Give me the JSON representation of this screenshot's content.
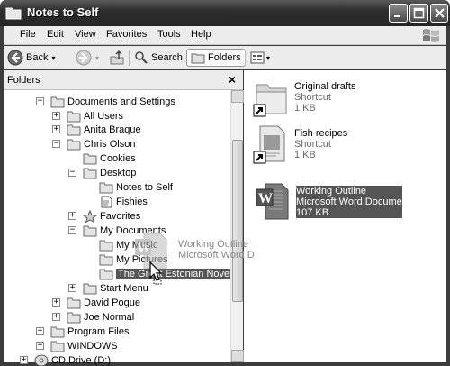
{
  "window": {
    "title": "Notes to Self"
  },
  "menubar": {
    "items": [
      "File",
      "Edit",
      "View",
      "Favorites",
      "Tools",
      "Help"
    ]
  },
  "toolbar": {
    "back_label": "Back",
    "search_label": "Search",
    "folders_label": "Folders"
  },
  "folders_pane": {
    "title": "Folders",
    "close_label": "×",
    "tree": [
      {
        "label": "Documents and Settings",
        "expander": "−"
      },
      {
        "label": "All Users",
        "expander": "+"
      },
      {
        "label": "Anita Braque",
        "expander": "+"
      },
      {
        "label": "Chris Olson",
        "expander": "−"
      },
      {
        "label": "Cookies",
        "expander": ""
      },
      {
        "label": "Desktop",
        "expander": "−"
      },
      {
        "label": "Notes to Self",
        "expander": ""
      },
      {
        "label": "Fishies",
        "expander": ""
      },
      {
        "label": "Favorites",
        "expander": "+"
      },
      {
        "label": "My Documents",
        "expander": "−"
      },
      {
        "label": "My Music",
        "expander": ""
      },
      {
        "label": "My Pictures",
        "expander": ""
      },
      {
        "label": "The Great Estonian Novel",
        "expander": "",
        "selected": true
      },
      {
        "label": "Start Menu",
        "expander": "+"
      },
      {
        "label": "David Pogue",
        "expander": "+"
      },
      {
        "label": "Joe Normal",
        "expander": "+"
      },
      {
        "label": "Program Files",
        "expander": "+"
      },
      {
        "label": "WINDOWS",
        "expander": "+"
      },
      {
        "label": "CD Drive (D:)",
        "expander": "+"
      }
    ]
  },
  "content": {
    "files": [
      {
        "name": "Original drafts",
        "type": "Shortcut",
        "size": "1 KB",
        "icon": "folder-shortcut-icon"
      },
      {
        "name": "Fish recipes",
        "type": "Shortcut",
        "size": "1 KB",
        "icon": "document-shortcut-icon"
      },
      {
        "name": "Working Outline",
        "type": "Microsoft Word Document",
        "size": "107 KB",
        "icon": "word-document-icon",
        "selected": true
      }
    ]
  },
  "drag_ghost": {
    "name": "Working Outline",
    "type": "Microsoft Word D"
  },
  "colors": {
    "titlebar": "#2e2e2e",
    "selection": "#555555",
    "chrome": "#ececec"
  }
}
